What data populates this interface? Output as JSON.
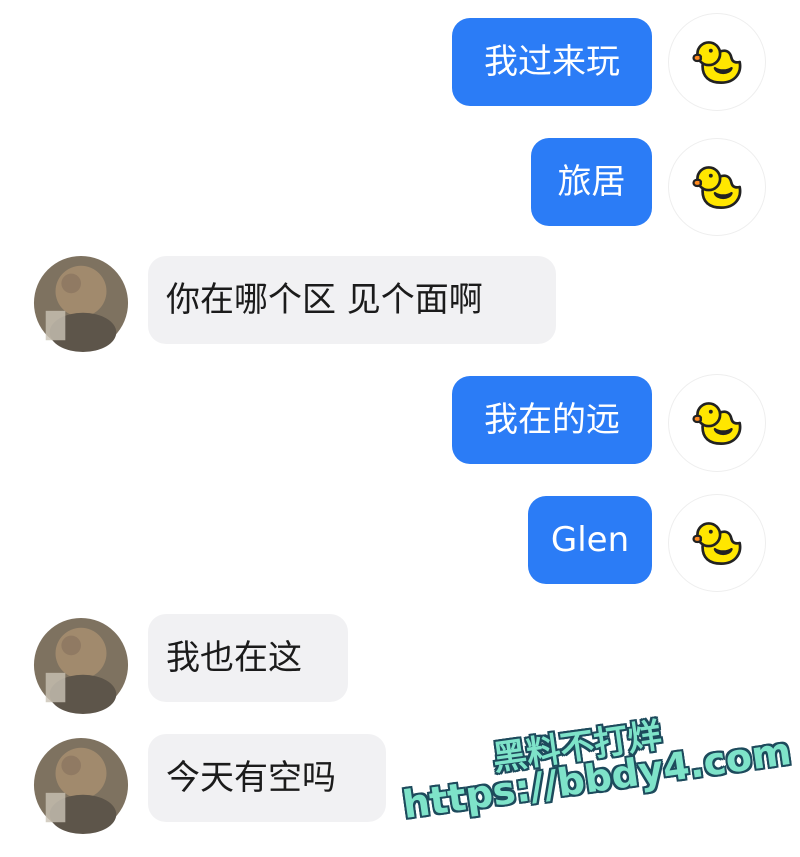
{
  "messages": [
    {
      "sender": "me",
      "text": "我过来玩",
      "avatar": "duck-icon"
    },
    {
      "sender": "me",
      "text": "旅居",
      "avatar": "duck-icon"
    },
    {
      "sender": "them",
      "text": "你在哪个区 见个面啊",
      "avatar": "blurred-photo"
    },
    {
      "sender": "me",
      "text": "我在的远",
      "avatar": "duck-icon"
    },
    {
      "sender": "me",
      "text": "Glen",
      "avatar": "duck-icon"
    },
    {
      "sender": "them",
      "text": "我也在这",
      "avatar": "blurred-photo"
    },
    {
      "sender": "them",
      "text": "今天有空吗",
      "avatar": "blurred-photo"
    }
  ],
  "watermark": {
    "line1": "黑料不打烊",
    "line2": "https://bbdy4.com"
  },
  "colors": {
    "my_bubble": "#2b7cf6",
    "their_bubble": "#f1f1f3",
    "watermark_fill": "#7ee3c9",
    "watermark_outline": "#1d4a5c"
  }
}
